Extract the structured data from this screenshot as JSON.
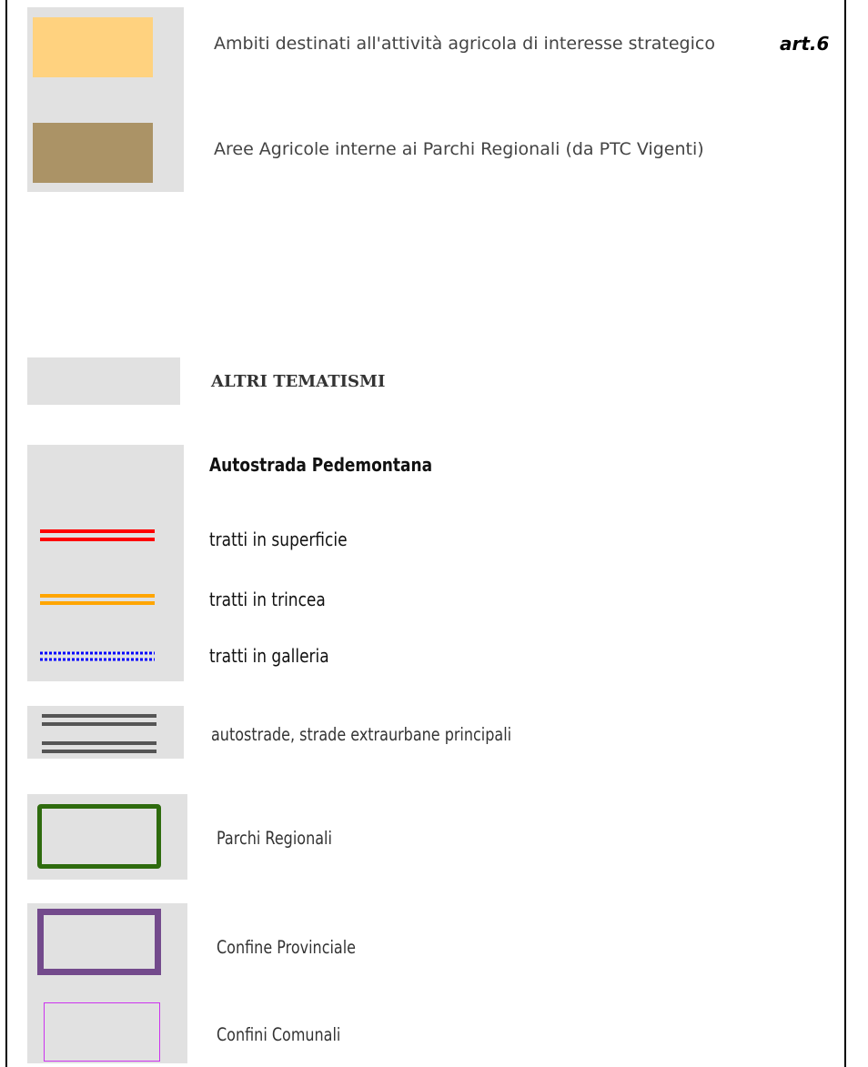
{
  "legend": {
    "agri_strategic": {
      "label": "Ambiti destinati all'attività agricola di interesse strategico",
      "ref": "art.6",
      "color": "#ffd27f"
    },
    "agri_parks": {
      "label": "Aree Agricole interne ai Parchi Regionali (da PTC Vigenti)",
      "color": "#ab9366"
    },
    "other_themes": {
      "heading": "ALTRI TEMATISMI"
    },
    "pedemontana": {
      "heading": "Autostrada Pedemontana",
      "items": [
        {
          "label": "tratti in superficie",
          "color": "#ff0000",
          "icon": "double-solid-line"
        },
        {
          "label": "tratti in trincea",
          "color": "#ffa500",
          "icon": "double-solid-line"
        },
        {
          "label": "tratti in galleria",
          "color": "#0000ff",
          "icon": "double-dotted-line"
        }
      ]
    },
    "highways": {
      "label": "autostrade, strade extraurbane principali",
      "color": "#555555",
      "icon": "double-solid-line"
    },
    "regional_parks": {
      "label": "Parchi Regionali",
      "color": "#2e6b0e",
      "icon": "outlined-rectangle"
    },
    "provincial_border": {
      "label": "Confine Provinciale",
      "color": "#734a8c",
      "icon": "outlined-rectangle"
    },
    "municipal_borders": {
      "label": "Confini Comunali",
      "color": "#cc33ee",
      "icon": "outlined-rectangle"
    }
  }
}
